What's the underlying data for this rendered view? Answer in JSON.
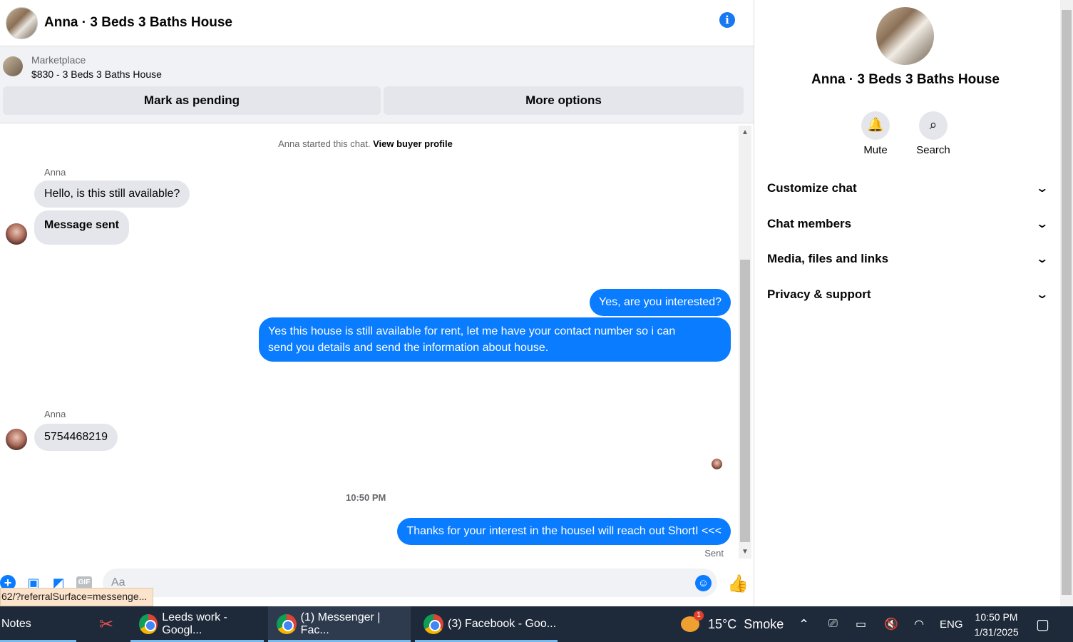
{
  "chat": {
    "title": "Anna · 3 Beds 3 Baths House",
    "info_glyph": "i",
    "marketplace_label": "Marketplace",
    "marketplace_item": "$830 - 3 Beds 3 Baths House",
    "mark_pending": "Mark as pending",
    "more_options": "More options"
  },
  "messages": {
    "started_text": "Anna started this chat.",
    "view_profile": "View buyer profile",
    "sender1": "Anna",
    "in1": "Hello, is this still available?",
    "in2": "Message sent",
    "out1": "Yes, are you interested?",
    "out2": "Yes this house is still available for rent, let me have your contact number so i can send you details and send the information about house.",
    "sender2": "Anna",
    "in3": "5754468219",
    "time": "10:50 PM",
    "out3": "Thanks for your interest in the houseI will reach out ShortI <<<",
    "status": "Sent"
  },
  "composer": {
    "placeholder": "Aa",
    "url_tooltip": "62/?referralSurface=messenge..."
  },
  "side": {
    "title": "Anna · 3 Beds 3 Baths House",
    "mute": "Mute",
    "search": "Search",
    "sections": [
      "Customize chat",
      "Chat members",
      "Media, files and links",
      "Privacy & support"
    ]
  },
  "taskbar": {
    "notes": "Notes",
    "app1": "Leeds work - Googl...",
    "app2": "(1) Messenger | Fac...",
    "app3": "(3) Facebook - Goo...",
    "weather_badge": "1",
    "temp": "15°C",
    "weather": "Smoke",
    "lang": "ENG",
    "time": "10:50 PM",
    "date": "1/31/2025"
  }
}
